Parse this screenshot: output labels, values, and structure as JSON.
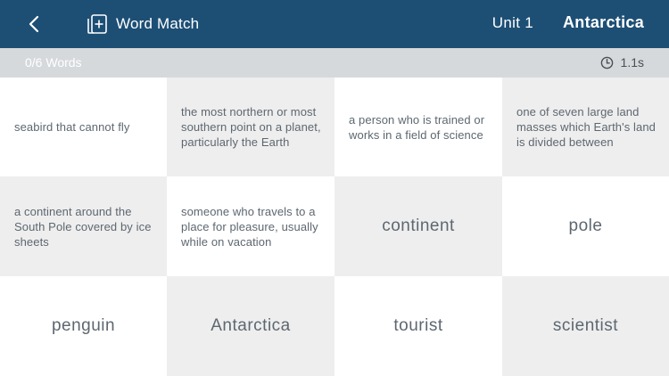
{
  "header": {
    "back_icon": "chevron-left-icon",
    "app_icon": "card-add-icon",
    "app_title": "Word Match",
    "unit": "Unit 1",
    "topic": "Antarctica",
    "background": "#1d4f75"
  },
  "status": {
    "word_count": "0/6 Words",
    "timer_icon": "clock-icon",
    "timer": "1.1s"
  },
  "cards": [
    {
      "text": "seabird that cannot fly",
      "kind": "definition",
      "shade": "white"
    },
    {
      "text": "the most northern or most southern point on a planet, particularly the Earth",
      "kind": "definition",
      "shade": "gray"
    },
    {
      "text": "a person who is trained or works in a field of science",
      "kind": "definition",
      "shade": "white"
    },
    {
      "text": "one of seven large land masses which Earth's land is divided between",
      "kind": "definition",
      "shade": "gray"
    },
    {
      "text": "a continent around the South Pole covered by ice sheets",
      "kind": "definition",
      "shade": "gray"
    },
    {
      "text": "someone who travels to a place for pleasure, usually while on vacation",
      "kind": "definition",
      "shade": "white"
    },
    {
      "text": "continent",
      "kind": "word",
      "shade": "gray"
    },
    {
      "text": "pole",
      "kind": "word",
      "shade": "white"
    },
    {
      "text": "penguin",
      "kind": "word",
      "shade": "white"
    },
    {
      "text": "Antarctica",
      "kind": "word",
      "shade": "gray"
    },
    {
      "text": "tourist",
      "kind": "word",
      "shade": "white"
    },
    {
      "text": "scientist",
      "kind": "word",
      "shade": "gray"
    }
  ]
}
